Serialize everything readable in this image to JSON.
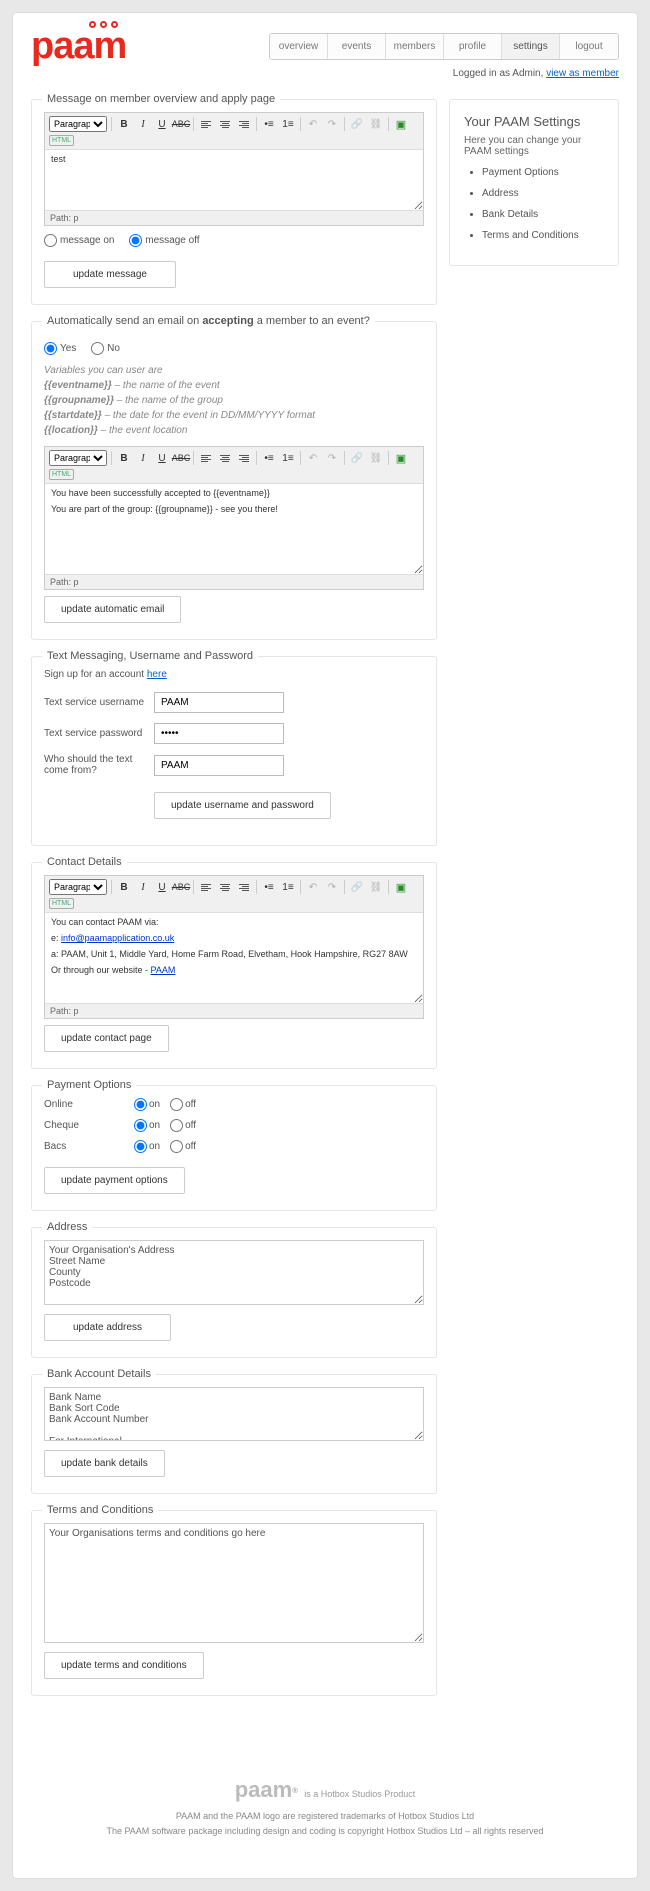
{
  "logo": "paam",
  "nav": [
    "overview",
    "events",
    "members",
    "profile",
    "settings",
    "logout"
  ],
  "nav_active": "settings",
  "login": {
    "prefix": "Logged in as Admin, ",
    "link": "view as member"
  },
  "sidebar": {
    "title": "Your PAAM Settings",
    "desc": "Here you can change your PAAM settings",
    "items": [
      "Payment Options",
      "Address",
      "Bank Details",
      "Terms and Conditions"
    ]
  },
  "toolbar": {
    "format": "Paragraph",
    "bold": "B",
    "italic": "I",
    "underline": "U",
    "strike": "ABC",
    "undo": "↶",
    "redo": "↷",
    "link": "🔗",
    "unlink": "⛓",
    "image": "▣",
    "html": "HTML",
    "ul": "•≡",
    "ol": "1≡"
  },
  "section1": {
    "legend": "Message on member overview and apply page",
    "content": "test",
    "path": "Path: p",
    "radio_on": "message on",
    "radio_off": "message off",
    "btn": "update message"
  },
  "section2": {
    "legend_a": "Automatically send an email on ",
    "legend_b": "accepting",
    "legend_c": " a member to an event?",
    "yes": "Yes",
    "no": "No",
    "help_intro": "Variables you can user are",
    "help1a": "{{eventname}}",
    "help1b": " – the name of the event",
    "help2a": "{{groupname}}",
    "help2b": " – the name of the group",
    "help3a": "{{startdate}}",
    "help3b": " – the date for the event in DD/MM/YYYY format",
    "help4a": "{{location}}",
    "help4b": " – the event location",
    "line1": "You have been successfully accepted to {{eventname}}",
    "line2": "You are part of the group: {{groupname}} - see you there!",
    "path": "Path: p",
    "btn": "update automatic email"
  },
  "section3": {
    "legend": "Text Messaging, Username and Password",
    "signup_a": "Sign up for an account ",
    "signup_b": "here",
    "lbl_user": "Text service username",
    "val_user": "PAAM",
    "lbl_pass": "Text service password",
    "val_pass": "•••••",
    "lbl_from": "Who should the text come from?",
    "val_from": "PAAM",
    "btn": "update username and password"
  },
  "section4": {
    "legend": "Contact Details",
    "l1": "You can contact PAAM via:",
    "l2a": "e: ",
    "l2b": "info@paamapplication.co.uk",
    "l3": "a: PAAM, Unit 1, Middle Yard, Home Farm Road, Elvetham, Hook Hampshire, RG27 8AW",
    "l4a": "Or through our website - ",
    "l4b": "PAAM",
    "path": "Path: p",
    "btn": "update contact page"
  },
  "section5": {
    "legend": "Payment Options",
    "rows": [
      {
        "label": "Online"
      },
      {
        "label": "Cheque"
      },
      {
        "label": "Bacs"
      }
    ],
    "on": "on",
    "off": "off",
    "btn": "update payment options"
  },
  "section6": {
    "legend": "Address",
    "value": "Your Organisation's Address\nStreet Name\nCounty\nPostcode",
    "btn": "update address"
  },
  "section7": {
    "legend": "Bank Account Details",
    "value": "Bank Name\nBank Sort Code\nBank Account Number\n\nFor International\nIBAN: XXXXXXXXXXXXXXXX",
    "btn": "update bank details"
  },
  "section8": {
    "legend": "Terms and Conditions",
    "value": "Your Organisations terms and conditions go here",
    "btn": "update terms and conditions"
  },
  "footer": {
    "logo": "paam",
    "reg": "®",
    "tag": "is a Hotbox Studios Product",
    "l1": "PAAM and the PAAM logo are registered trademarks of Hotbox Studios Ltd",
    "l2": "The PAAM software package including design and coding is copyright Hotbox Studios Ltd – all rights reserved"
  }
}
